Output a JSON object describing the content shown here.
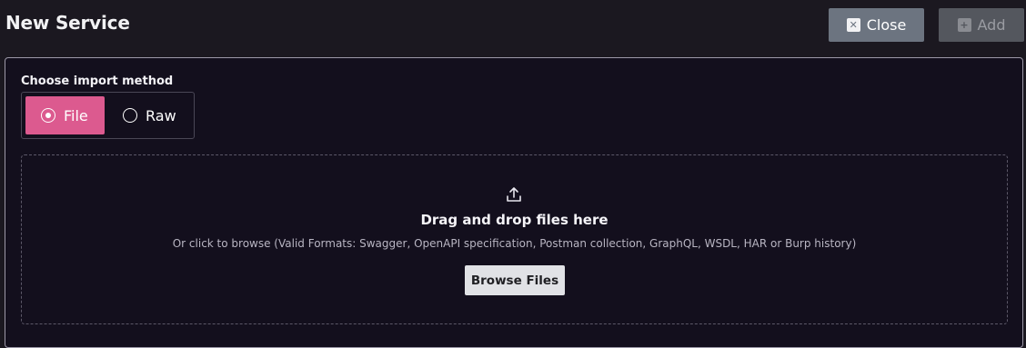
{
  "header": {
    "title": "New Service",
    "close_label": "Close",
    "close_icon": "close-icon",
    "add_label": "Add",
    "add_icon": "plus-icon"
  },
  "import": {
    "label": "Choose import method",
    "options": [
      {
        "label": "File",
        "selected": true
      },
      {
        "label": "Raw",
        "selected": false
      }
    ]
  },
  "dropzone": {
    "icon": "upload-icon",
    "title": "Drag and drop files here",
    "subtitle": "Or click to browse (Valid Formats: Swagger, OpenAPI specification, Postman collection, GraphQL, WSDL, HAR or Burp history)",
    "browse_label": "Browse Files"
  },
  "colors": {
    "background": "#1b1820",
    "panel": "#130f1d",
    "accent": "#dc5a8f",
    "close_button": "#6c7480",
    "add_button_disabled": "#54575e"
  }
}
